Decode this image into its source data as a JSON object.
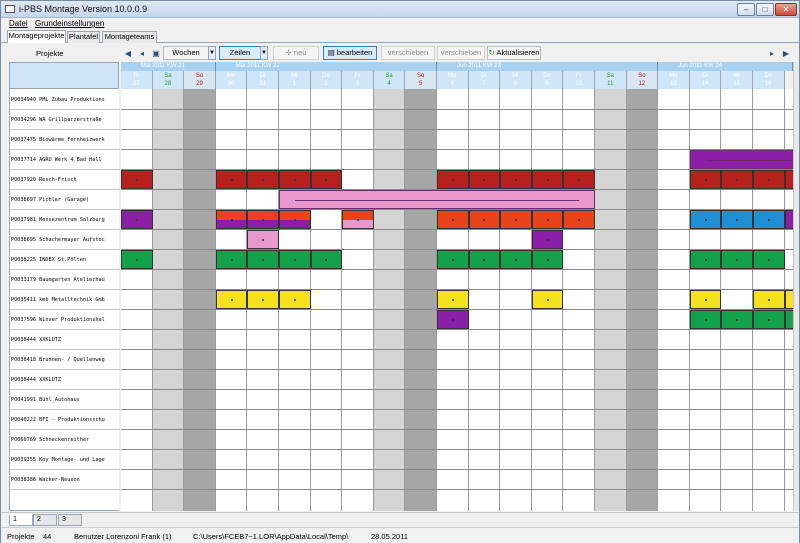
{
  "window": {
    "title": "i-PBS Montage Version 10.0.0.9",
    "buttons": {
      "minimize": "–",
      "maximize": "□",
      "close": "✕"
    }
  },
  "menu": [
    {
      "label": "Datei"
    },
    {
      "label": "Grundeinstellungen"
    }
  ],
  "tabs": [
    {
      "label": "Montageprojekte"
    },
    {
      "label": "Plantafel"
    },
    {
      "label": "Montageteams"
    }
  ],
  "toolbar": {
    "projekte_label": "Projekte",
    "view_select": "Wochen",
    "rows_select": "Zeilen",
    "new_label": "neu",
    "edit_label": "bearbeiten",
    "move1_label": "verschieben",
    "move2_label": "verschieben",
    "refresh_label": "Aktualisieren"
  },
  "weeks": [
    {
      "label": "Mai 2011 KW 21"
    },
    {
      "label": "Mai 2011 KW 22"
    },
    {
      "label": "Jun 2011 KW 23"
    },
    {
      "label": "Jun 2011 KW 24"
    }
  ],
  "days": [
    {
      "name": "Fr",
      "num": "27",
      "type": "weekday"
    },
    {
      "name": "Sa",
      "num": "28",
      "type": "saturday"
    },
    {
      "name": "So",
      "num": "29",
      "type": "sunday"
    },
    {
      "name": "Mo",
      "num": "30",
      "type": "weekday"
    },
    {
      "name": "Di",
      "num": "31",
      "type": "weekday"
    },
    {
      "name": "Mi",
      "num": "1",
      "type": "weekday"
    },
    {
      "name": "Do",
      "num": "2",
      "type": "weekday"
    },
    {
      "name": "Fr",
      "num": "3",
      "type": "weekday"
    },
    {
      "name": "Sa",
      "num": "4",
      "type": "saturday"
    },
    {
      "name": "So",
      "num": "5",
      "type": "sunday"
    },
    {
      "name": "Mo",
      "num": "6",
      "type": "weekday"
    },
    {
      "name": "Di",
      "num": "7",
      "type": "weekday"
    },
    {
      "name": "Mi",
      "num": "8",
      "type": "weekday"
    },
    {
      "name": "Do",
      "num": "9",
      "type": "weekday"
    },
    {
      "name": "Fr",
      "num": "10",
      "type": "weekday"
    },
    {
      "name": "Sa",
      "num": "11",
      "type": "saturday"
    },
    {
      "name": "So",
      "num": "12",
      "type": "sunday"
    },
    {
      "name": "Mo",
      "num": "13",
      "type": "weekday"
    },
    {
      "name": "Di",
      "num": "14",
      "type": "weekday"
    },
    {
      "name": "Mi",
      "num": "15",
      "type": "weekday"
    },
    {
      "name": "Do",
      "num": "16",
      "type": "weekday"
    }
  ],
  "projects": [
    "PO034940 PML Zubau Produktions",
    "PO034296 WA Grillparzerstraße",
    "PO037475 Biowärme Fernheizwerk",
    "PO037714 AGRU Werk 4 Bad Hall",
    "PO037920 Resch-Frisch",
    "PO038697 Pichler (Garage)",
    "PO037981 Messezentrum Salzburg",
    "PO038695 Schachermayer Aufstoc",
    "PO038225 INDEX St.Pölten",
    "PO033179 Baumgarten Atelierhau",
    "PO035411 kmb Metalltechnik Gmb",
    "PO037596 Winser Produktionshal",
    "PO038444 XXKLUTZ",
    "PO038418 Brunnen- / Quellenweg",
    "PO038444 XXKLUTZ",
    "PO041991 Bühl_Autohaus",
    "PO040222 BFI - Produktionsschu",
    "PO060769 Schneckenreither",
    "PO039355 Kny Montage- und Lage",
    "PO038386 Wacker-Neuson"
  ],
  "colors": {
    "dark_red": "#b8201e",
    "orange_red": "#e8431a",
    "pink": "#e898cc",
    "purple": "#8b1fa8",
    "green": "#13a24a",
    "yellow": "#f5e11e",
    "blue": "#1f8fd6",
    "saturday_shade": "#d4d4d4",
    "sunday_shade": "#a6a6a6"
  },
  "schedule": [
    {
      "row": 4,
      "col": 0,
      "span": 1,
      "color": "dark_red"
    },
    {
      "row": 4,
      "col": 3,
      "span": 4,
      "color": "dark_red"
    },
    {
      "row": 4,
      "col": 10,
      "span": 5,
      "color": "dark_red"
    },
    {
      "row": 4,
      "col": 18,
      "span": 4,
      "color": "dark_red"
    },
    {
      "row": 3,
      "col": 18,
      "span": 4,
      "color": "purple",
      "line": true
    },
    {
      "row": 5,
      "col": 5,
      "span": 10,
      "color": "pink",
      "line": true
    },
    {
      "row": 6,
      "col": 0,
      "span": 1,
      "color": "purple"
    },
    {
      "row": 6,
      "col": 3,
      "span": 3,
      "color": "orange_red",
      "split": "purple"
    },
    {
      "row": 6,
      "col": 7,
      "span": 1,
      "color": "orange_red",
      "split": "pink"
    },
    {
      "row": 6,
      "col": 10,
      "span": 5,
      "color": "orange_red"
    },
    {
      "row": 6,
      "col": 18,
      "span": 4,
      "color": "blue",
      "split_last": "purple"
    },
    {
      "row": 7,
      "col": 4,
      "span": 1,
      "color": "pink"
    },
    {
      "row": 7,
      "col": 13,
      "span": 1,
      "color": "purple"
    },
    {
      "row": 8,
      "col": 0,
      "span": 1,
      "color": "green"
    },
    {
      "row": 8,
      "col": 3,
      "span": 4,
      "color": "green"
    },
    {
      "row": 8,
      "col": 10,
      "span": 4,
      "color": "green"
    },
    {
      "row": 8,
      "col": 18,
      "span": 3,
      "color": "green"
    },
    {
      "row": 10,
      "col": 3,
      "span": 3,
      "color": "yellow"
    },
    {
      "row": 10,
      "col": 10,
      "span": 1,
      "color": "yellow"
    },
    {
      "row": 10,
      "col": 13,
      "span": 1,
      "color": "yellow"
    },
    {
      "row": 10,
      "col": 18,
      "span": 1,
      "color": "yellow"
    },
    {
      "row": 10,
      "col": 20,
      "span": 2,
      "color": "yellow"
    },
    {
      "row": 11,
      "col": 10,
      "span": 1,
      "color": "purple"
    },
    {
      "row": 11,
      "col": 18,
      "span": 4,
      "color": "green"
    }
  ],
  "bottom_tabs": [
    {
      "label": "1"
    },
    {
      "label": "2"
    },
    {
      "label": "3"
    }
  ],
  "status": {
    "projects_label": "Projekte",
    "projects_count": "44",
    "user": "Benutzer Lorenzoni Frank (1)",
    "path": "C:\\Users\\FCEB7~1.LOR\\AppData\\Local\\Temp\\",
    "date": "28.05.2011"
  }
}
